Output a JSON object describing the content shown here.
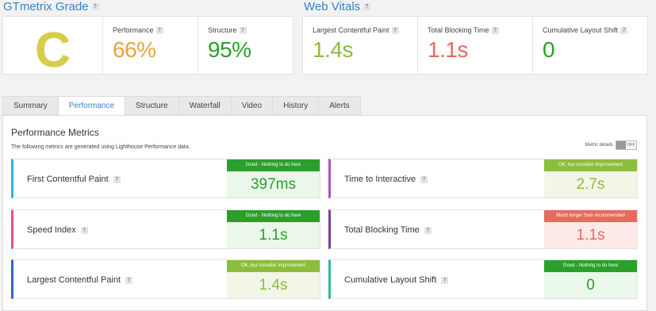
{
  "grade": {
    "title": "GTmetrix Grade",
    "letter": "C",
    "performance_label": "Performance",
    "performance_value": "66%",
    "structure_label": "Structure",
    "structure_value": "95%"
  },
  "vitals": {
    "title": "Web Vitals",
    "lcp_label": "Largest Contentful Paint",
    "lcp_value": "1.4s",
    "tbt_label": "Total Blocking Time",
    "tbt_value": "1.1s",
    "cls_label": "Cumulative Layout Shift",
    "cls_value": "0"
  },
  "help_glyph": "?",
  "tabs": [
    "Summary",
    "Performance",
    "Structure",
    "Waterfall",
    "Video",
    "History",
    "Alerts"
  ],
  "panel": {
    "title": "Performance Metrics",
    "subtitle": "The following metrics are generated using Lighthouse Performance data.",
    "toggle_label": "Metric details",
    "toggle_state": "OFF"
  },
  "metrics": [
    {
      "name": "First Contentful Paint",
      "badge": "Good - Nothing to do here",
      "value": "397ms",
      "status": "good",
      "accent": "#29b6e8"
    },
    {
      "name": "Time to Interactive",
      "badge": "OK, but consider improvement",
      "value": "2.7s",
      "status": "ok",
      "accent": "#b04fc8"
    },
    {
      "name": "Speed Index",
      "badge": "Good - Nothing to do here",
      "value": "1.1s",
      "status": "good",
      "accent": "#e8508f"
    },
    {
      "name": "Total Blocking Time",
      "badge": "Much longer than recommended",
      "value": "1.1s",
      "status": "bad",
      "accent": "#7a3f9a"
    },
    {
      "name": "Largest Contentful Paint",
      "badge": "OK, but consider improvement",
      "value": "1.4s",
      "status": "ok",
      "accent": "#3564c8"
    },
    {
      "name": "Cumulative Layout Shift",
      "badge": "Good - Nothing to do here",
      "value": "0",
      "status": "good",
      "accent": "#2fb89a"
    }
  ],
  "colors": {
    "grade_c": "#d4cc4a",
    "performance": "#e8a33b",
    "structure": "#2aa02a",
    "good": "#2aa02a",
    "ok": "#8dbd3c",
    "bad": "#e86a5e",
    "link": "#3b82c4"
  }
}
